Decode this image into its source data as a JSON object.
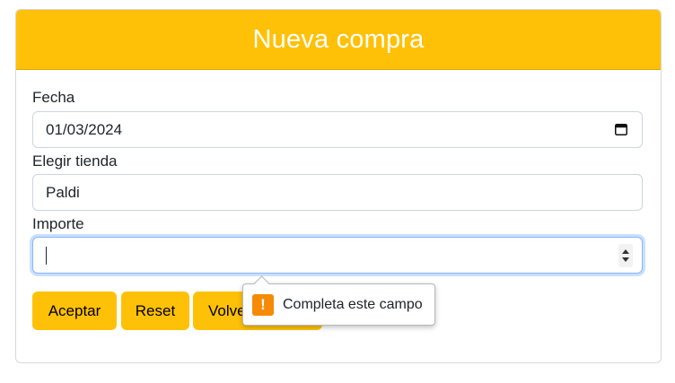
{
  "header": {
    "title": "Nueva compra"
  },
  "form": {
    "fecha": {
      "label": "Fecha",
      "value": "01/03/2024"
    },
    "tienda": {
      "label": "Elegir tienda",
      "value": "Paldi"
    },
    "importe": {
      "label": "Importe",
      "value": ""
    }
  },
  "buttons": {
    "accept": "Aceptar",
    "reset": "Reset",
    "back": "Volver"
  },
  "validation": {
    "message": "Completa este campo",
    "icon": "warning-icon"
  },
  "colors": {
    "accent": "#ffc107",
    "warning": "#f58a07",
    "focus": "#86b7fe"
  }
}
